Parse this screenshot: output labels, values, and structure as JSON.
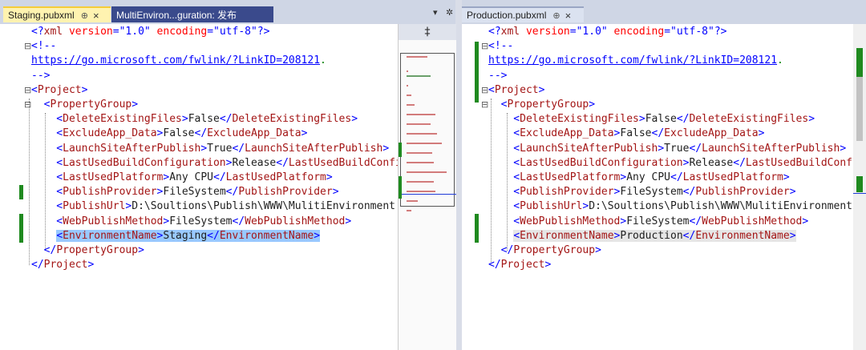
{
  "left": {
    "tabs": [
      {
        "label": "Staging.pubxml",
        "pin": "⊕",
        "close": "×"
      },
      {
        "label": "MultiEnviron...guration: 发布"
      }
    ],
    "strip_buttons": {
      "dropdown": "▾",
      "settings": "✲"
    },
    "lines": [
      {
        "fold": "",
        "parts": [
          [
            "b",
            "<?"
          ],
          [
            "t",
            "xml"
          ],
          [
            "a",
            " version"
          ],
          [
            "b",
            "="
          ],
          [
            "s",
            "\"1.0\""
          ],
          [
            "a",
            " encoding"
          ],
          [
            "b",
            "="
          ],
          [
            "s",
            "\"utf-8\""
          ],
          [
            "b",
            "?>"
          ]
        ]
      },
      {
        "fold": "⊟",
        "parts": [
          [
            "b",
            "<!--"
          ]
        ]
      },
      {
        "fold": "",
        "parts": [
          [
            "link",
            "https://go.microsoft.com/fwlink/?LinkID=208121"
          ],
          [
            "c",
            "."
          ]
        ]
      },
      {
        "fold": "",
        "parts": [
          [
            "b",
            "-->"
          ]
        ]
      },
      {
        "fold": "⊟",
        "parts": [
          [
            "b",
            "<"
          ],
          [
            "t",
            "Project"
          ],
          [
            "b",
            ">"
          ]
        ]
      },
      {
        "fold": "⊟",
        "parts": [
          [
            "b",
            "  <"
          ],
          [
            "t",
            "PropertyGroup"
          ],
          [
            "b",
            ">"
          ]
        ]
      },
      {
        "fold": "",
        "parts": [
          [
            "b",
            "    <"
          ],
          [
            "t",
            "DeleteExistingFiles"
          ],
          [
            "b",
            ">"
          ],
          [
            "x",
            "False"
          ],
          [
            "b",
            "</"
          ],
          [
            "t",
            "DeleteExistingFiles"
          ],
          [
            "b",
            ">"
          ]
        ]
      },
      {
        "fold": "",
        "parts": [
          [
            "b",
            "    <"
          ],
          [
            "t",
            "ExcludeApp_Data"
          ],
          [
            "b",
            ">"
          ],
          [
            "x",
            "False"
          ],
          [
            "b",
            "</"
          ],
          [
            "t",
            "ExcludeApp_Data"
          ],
          [
            "b",
            ">"
          ]
        ]
      },
      {
        "fold": "",
        "parts": [
          [
            "b",
            "    <"
          ],
          [
            "t",
            "LaunchSiteAfterPublish"
          ],
          [
            "b",
            ">"
          ],
          [
            "x",
            "True"
          ],
          [
            "b",
            "</"
          ],
          [
            "t",
            "LaunchSiteAfterPublish"
          ],
          [
            "b",
            ">"
          ]
        ]
      },
      {
        "fold": "",
        "parts": [
          [
            "b",
            "    <"
          ],
          [
            "t",
            "LastUsedBuildConfiguration"
          ],
          [
            "b",
            ">"
          ],
          [
            "x",
            "Release"
          ],
          [
            "b",
            "</"
          ],
          [
            "t",
            "LastUsedBuildConfiguration"
          ],
          [
            "b",
            ">"
          ]
        ]
      },
      {
        "fold": "",
        "parts": [
          [
            "b",
            "    <"
          ],
          [
            "t",
            "LastUsedPlatform"
          ],
          [
            "b",
            ">"
          ],
          [
            "x",
            "Any CPU"
          ],
          [
            "b",
            "</"
          ],
          [
            "t",
            "LastUsedPlatform"
          ],
          [
            "b",
            ">"
          ]
        ]
      },
      {
        "fold": "",
        "parts": [
          [
            "b",
            "    <"
          ],
          [
            "t",
            "PublishProvider"
          ],
          [
            "b",
            ">"
          ],
          [
            "x",
            "FileSystem"
          ],
          [
            "b",
            "</"
          ],
          [
            "t",
            "PublishProvider"
          ],
          [
            "b",
            ">"
          ]
        ]
      },
      {
        "fold": "",
        "parts": [
          [
            "b",
            "    <"
          ],
          [
            "t",
            "PublishUrl"
          ],
          [
            "b",
            ">"
          ],
          [
            "x",
            "D:\\Soultions\\Publish\\WWW\\MulitiEnvironment"
          ]
        ]
      },
      {
        "fold": "",
        "parts": [
          [
            "b",
            "    <"
          ],
          [
            "t",
            "WebPublishMethod"
          ],
          [
            "b",
            ">"
          ],
          [
            "x",
            "FileSystem"
          ],
          [
            "b",
            "</"
          ],
          [
            "t",
            "WebPublishMethod"
          ],
          [
            "b",
            ">"
          ]
        ]
      },
      {
        "fold": "",
        "hi": "sel",
        "parts": [
          [
            "x",
            "    "
          ],
          [
            "b",
            "<"
          ],
          [
            "t",
            "EnvironmentName"
          ],
          [
            "b",
            ">"
          ],
          [
            "x",
            "Staging"
          ],
          [
            "b",
            "</"
          ],
          [
            "t",
            "EnvironmentName"
          ],
          [
            "b",
            ">"
          ]
        ]
      },
      {
        "fold": "",
        "parts": [
          [
            "b",
            "  </"
          ],
          [
            "t",
            "PropertyGroup"
          ],
          [
            "b",
            ">"
          ]
        ]
      },
      {
        "fold": "",
        "parts": [
          [
            "b",
            "</"
          ],
          [
            "t",
            "Project"
          ],
          [
            "b",
            ">"
          ]
        ]
      }
    ]
  },
  "right": {
    "tabs": [
      {
        "label": "Production.pubxml",
        "pin": "⊕",
        "close": "×"
      }
    ],
    "lines": [
      {
        "fold": "",
        "parts": [
          [
            "b",
            "<?"
          ],
          [
            "t",
            "xml"
          ],
          [
            "a",
            " version"
          ],
          [
            "b",
            "="
          ],
          [
            "s",
            "\"1.0\""
          ],
          [
            "a",
            " encoding"
          ],
          [
            "b",
            "="
          ],
          [
            "s",
            "\"utf-8\""
          ],
          [
            "b",
            "?>"
          ]
        ]
      },
      {
        "fold": "⊟",
        "parts": [
          [
            "b",
            "<!--"
          ]
        ]
      },
      {
        "fold": "",
        "parts": [
          [
            "link",
            "https://go.microsoft.com/fwlink/?LinkID=208121"
          ],
          [
            "c",
            "."
          ]
        ]
      },
      {
        "fold": "",
        "parts": [
          [
            "b",
            "-->"
          ]
        ]
      },
      {
        "fold": "⊟",
        "parts": [
          [
            "b",
            "<"
          ],
          [
            "t",
            "Project"
          ],
          [
            "b",
            ">"
          ]
        ]
      },
      {
        "fold": "⊟",
        "parts": [
          [
            "b",
            "  <"
          ],
          [
            "t",
            "PropertyGroup"
          ],
          [
            "b",
            ">"
          ]
        ]
      },
      {
        "fold": "",
        "parts": [
          [
            "b",
            "    <"
          ],
          [
            "t",
            "DeleteExistingFiles"
          ],
          [
            "b",
            ">"
          ],
          [
            "x",
            "False"
          ],
          [
            "b",
            "</"
          ],
          [
            "t",
            "DeleteExistingFiles"
          ],
          [
            "b",
            ">"
          ]
        ]
      },
      {
        "fold": "",
        "parts": [
          [
            "b",
            "    <"
          ],
          [
            "t",
            "ExcludeApp_Data"
          ],
          [
            "b",
            ">"
          ],
          [
            "x",
            "False"
          ],
          [
            "b",
            "</"
          ],
          [
            "t",
            "ExcludeApp_Data"
          ],
          [
            "b",
            ">"
          ]
        ]
      },
      {
        "fold": "",
        "parts": [
          [
            "b",
            "    <"
          ],
          [
            "t",
            "LaunchSiteAfterPublish"
          ],
          [
            "b",
            ">"
          ],
          [
            "x",
            "True"
          ],
          [
            "b",
            "</"
          ],
          [
            "t",
            "LaunchSiteAfterPublish"
          ],
          [
            "b",
            ">"
          ]
        ]
      },
      {
        "fold": "",
        "parts": [
          [
            "b",
            "    <"
          ],
          [
            "t",
            "LastUsedBuildConfiguration"
          ],
          [
            "b",
            ">"
          ],
          [
            "x",
            "Release"
          ],
          [
            "b",
            "</"
          ],
          [
            "t",
            "LastUsedBuildConfiguration"
          ],
          [
            "b",
            ">"
          ]
        ]
      },
      {
        "fold": "",
        "parts": [
          [
            "b",
            "    <"
          ],
          [
            "t",
            "LastUsedPlatform"
          ],
          [
            "b",
            ">"
          ],
          [
            "x",
            "Any CPU"
          ],
          [
            "b",
            "</"
          ],
          [
            "t",
            "LastUsedPlatform"
          ],
          [
            "b",
            ">"
          ]
        ]
      },
      {
        "fold": "",
        "parts": [
          [
            "b",
            "    <"
          ],
          [
            "t",
            "PublishProvider"
          ],
          [
            "b",
            ">"
          ],
          [
            "x",
            "FileSystem"
          ],
          [
            "b",
            "</"
          ],
          [
            "t",
            "PublishProvider"
          ],
          [
            "b",
            ">"
          ]
        ]
      },
      {
        "fold": "",
        "parts": [
          [
            "b",
            "    <"
          ],
          [
            "t",
            "PublishUrl"
          ],
          [
            "b",
            ">"
          ],
          [
            "x",
            "D:\\Soultions\\Publish\\WWW\\MulitiEnvironment"
          ]
        ]
      },
      {
        "fold": "",
        "parts": [
          [
            "b",
            "    <"
          ],
          [
            "t",
            "WebPublishMethod"
          ],
          [
            "b",
            ">"
          ],
          [
            "x",
            "FileSystem"
          ],
          [
            "b",
            "</"
          ],
          [
            "t",
            "WebPublishMethod"
          ],
          [
            "b",
            ">"
          ]
        ]
      },
      {
        "fold": "",
        "hi": "cur",
        "parts": [
          [
            "x",
            "    "
          ],
          [
            "b",
            "<"
          ],
          [
            "t",
            "EnvironmentName"
          ],
          [
            "b",
            ">"
          ],
          [
            "x",
            "Production"
          ],
          [
            "b",
            "</"
          ],
          [
            "t",
            "EnvironmentName"
          ],
          [
            "b",
            ">"
          ]
        ]
      },
      {
        "fold": "",
        "parts": [
          [
            "b",
            "  </"
          ],
          [
            "t",
            "PropertyGroup"
          ],
          [
            "b",
            ">"
          ]
        ]
      },
      {
        "fold": "",
        "parts": [
          [
            "b",
            "</"
          ],
          [
            "t",
            "Project"
          ],
          [
            "b",
            ">"
          ]
        ]
      }
    ]
  },
  "minimap": {
    "split_icon": "‡"
  },
  "colors": {
    "added": "#1f8a1f",
    "tag": "#a31515",
    "bracket": "#0000ff",
    "attr": "#ff0000",
    "selection": "#99c9ff"
  }
}
